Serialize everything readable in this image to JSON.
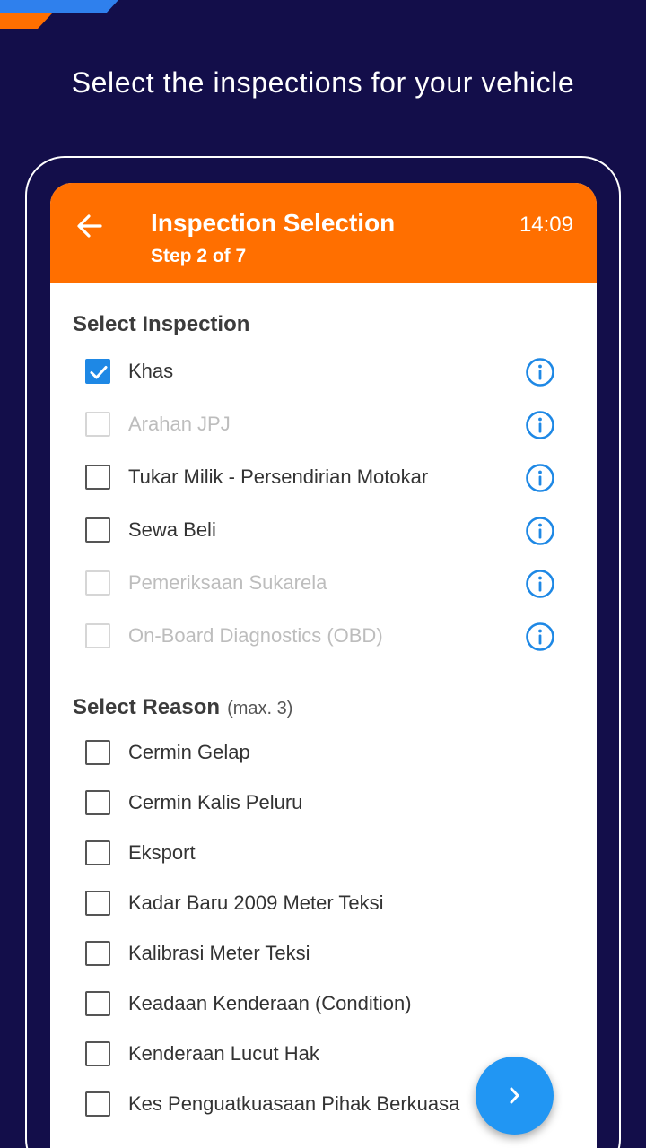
{
  "headline": "Select the inspections for your vehicle",
  "appbar": {
    "title": "Inspection Selection",
    "step": "Step 2 of 7",
    "time": "14:09",
    "color": "#ff6f00"
  },
  "inspection_section": {
    "title": "Select Inspection",
    "items": [
      {
        "label": "Khas",
        "checked": true,
        "disabled": false
      },
      {
        "label": "Arahan JPJ",
        "checked": false,
        "disabled": true
      },
      {
        "label": "Tukar Milik - Persendirian Motokar",
        "checked": false,
        "disabled": false
      },
      {
        "label": "Sewa Beli",
        "checked": false,
        "disabled": false
      },
      {
        "label": "Pemeriksaan Sukarela",
        "checked": false,
        "disabled": true
      },
      {
        "label": "On-Board Diagnostics (OBD)",
        "checked": false,
        "disabled": true
      }
    ]
  },
  "reason_section": {
    "title": "Select Reason",
    "note": "(max. 3)",
    "items": [
      {
        "label": "Cermin Gelap",
        "checked": false
      },
      {
        "label": "Cermin Kalis Peluru",
        "checked": false
      },
      {
        "label": "Eksport",
        "checked": false
      },
      {
        "label": "Kadar Baru 2009 Meter Teksi",
        "checked": false
      },
      {
        "label": "Kalibrasi Meter Teksi",
        "checked": false
      },
      {
        "label": "Keadaan Kenderaan (Condition)",
        "checked": false
      },
      {
        "label": "Kenderaan Lucut Hak",
        "checked": false
      },
      {
        "label": "Kes Penguatkuasaan Pihak Berkuasa",
        "checked": false
      }
    ]
  },
  "icons": {
    "back": "arrow-left-icon",
    "info": "info-circle-icon",
    "next": "chevron-right-icon"
  },
  "colors": {
    "background": "#130e4a",
    "accent": "#1e88e5",
    "appbar": "#ff6f00"
  }
}
